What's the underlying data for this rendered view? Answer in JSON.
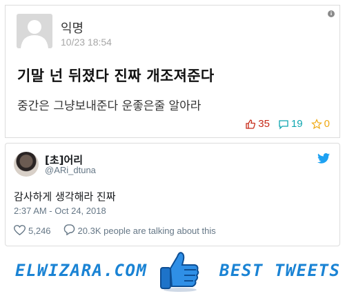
{
  "post": {
    "author": "익명",
    "time": "10/23 18:54",
    "title": "기말 넌 뒤졌다 진짜 개조져준다",
    "body": "중간은 그냥보내준다 운좋은줄 알아라",
    "likes": "35",
    "comments": "19",
    "scraps": "0",
    "info_icon": "i"
  },
  "tweet": {
    "name": "[초]어리",
    "handle": "@ARi_dtuna",
    "text": "감사하게 생각해라 진짜",
    "datetime": "2:37 AM - Oct 24, 2018",
    "likes": "5,246",
    "talking": "20.3K people are talking about this"
  },
  "banner": {
    "left_text": "ELWIZARA.COM",
    "right_text": "BEST TWEETS"
  },
  "colors": {
    "like": "#c62917",
    "comment": "#0ca5af",
    "scrap": "#f0a913",
    "twitter": "#1da1f2",
    "brand": "#1a83d4"
  },
  "icons": [
    "avatar-placeholder",
    "info-icon",
    "thumbs-up-icon",
    "speech-bubble-icon",
    "star-icon",
    "twitter-bird-icon",
    "heart-icon",
    "reply-bubble-icon",
    "thumbs-up-badge"
  ]
}
